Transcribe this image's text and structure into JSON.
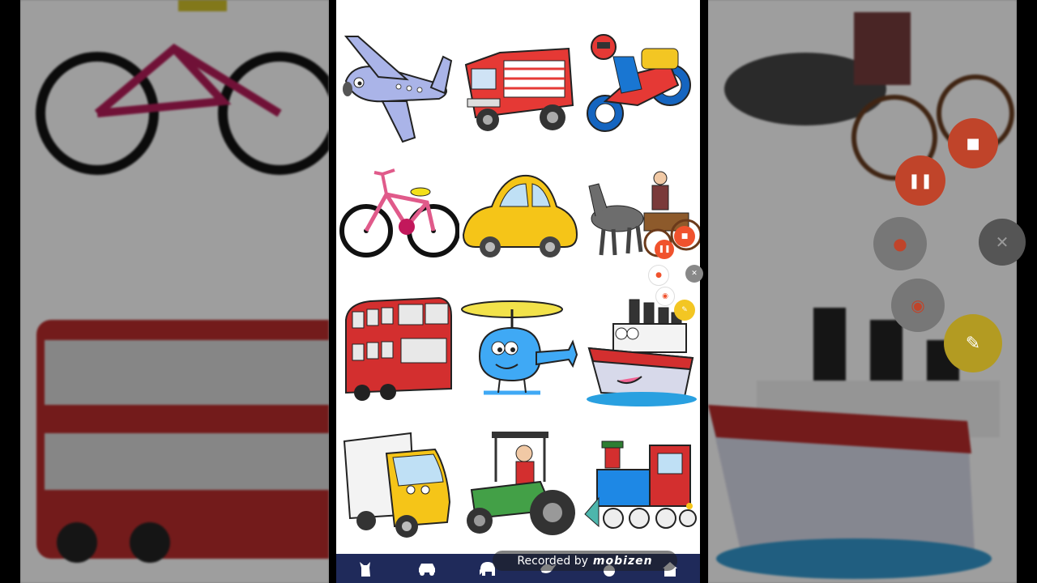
{
  "watermark": {
    "prefix": "Recorded by",
    "brand": "mobizen"
  },
  "tiles": [
    {
      "name": "airplane"
    },
    {
      "name": "fire-truck"
    },
    {
      "name": "motorcycle"
    },
    {
      "name": "bicycle"
    },
    {
      "name": "car"
    },
    {
      "name": "horse-cart"
    },
    {
      "name": "double-decker-bus"
    },
    {
      "name": "helicopter"
    },
    {
      "name": "ship"
    },
    {
      "name": "truck"
    },
    {
      "name": "tractor"
    },
    {
      "name": "train"
    }
  ],
  "bottom_nav": [
    "cat-icon",
    "car-icon",
    "elephant-icon",
    "bird-icon",
    "apple-icon",
    "home-icon"
  ],
  "colors": {
    "nav_bg": "#1f2a5a",
    "mobizen_red": "#f0522d",
    "mobizen_yellow": "#f3c623"
  }
}
